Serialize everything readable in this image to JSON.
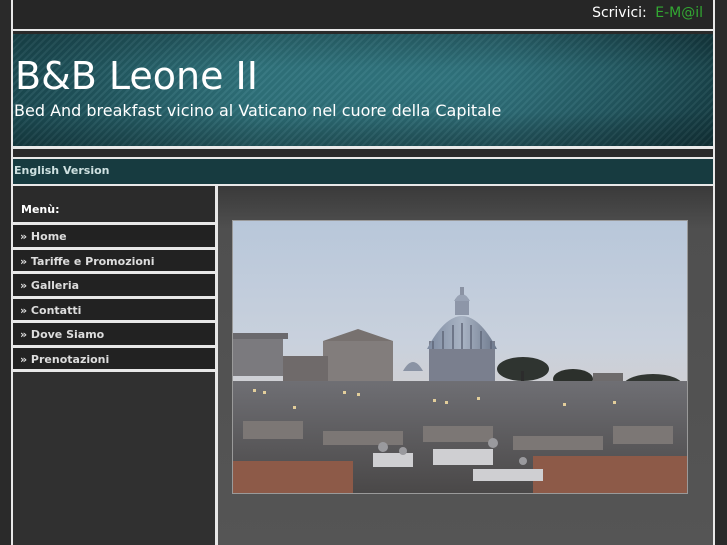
{
  "header": {
    "contact_label": "Scrivici:",
    "email_link": "E-M@il"
  },
  "banner": {
    "title": "B&B Leone II",
    "subtitle": "Bed And breakfast vicino al Vaticano nel cuore della Capitale"
  },
  "language_bar": {
    "english_link": "English Version"
  },
  "sidebar": {
    "heading": "Menù:",
    "items": [
      {
        "label": "» Home"
      },
      {
        "label": "» Tariffe e Promozioni"
      },
      {
        "label": "» Galleria"
      },
      {
        "label": "» Contatti"
      },
      {
        "label": "» Dove Siamo"
      },
      {
        "label": "» Prenotazioni"
      }
    ]
  },
  "content": {
    "photo_icon": "rome-skyline-photo"
  },
  "colors": {
    "banner_teal": "#2d6e77",
    "email_green": "#33a833",
    "frame_lines": "#e8e8e8",
    "background": "#2a2a2a"
  }
}
